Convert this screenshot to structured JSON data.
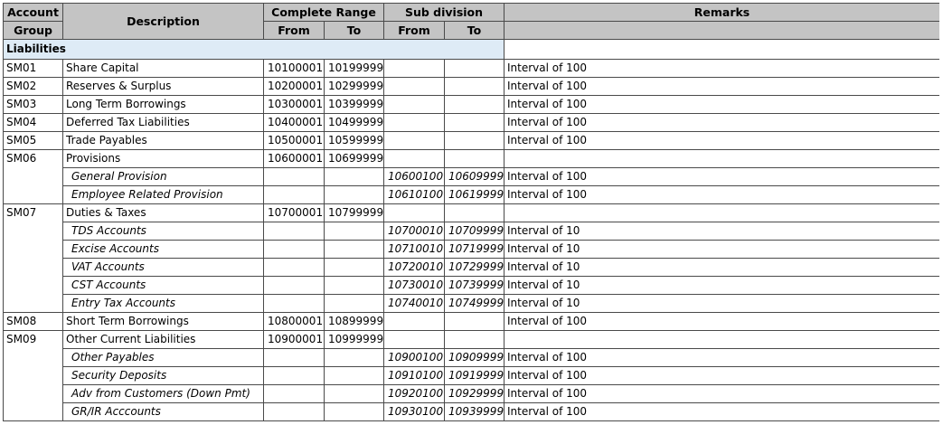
{
  "header": {
    "account_group": "Account Group",
    "account_group_line1": "Account",
    "account_group_line2": "Group",
    "description": "Description",
    "complete_range": "Complete Range",
    "sub_division": "Sub division",
    "remarks": "Remarks",
    "from": "From",
    "to": "To"
  },
  "section": "Liabilities",
  "rows": [
    {
      "group": "SM01",
      "desc": "Share Capital",
      "from": "10100001",
      "to": "10199999",
      "sub_from": "",
      "sub_to": "",
      "remarks": "Interval of 100",
      "sub": false
    },
    {
      "group": "SM02",
      "desc": "Reserves & Surplus",
      "from": "10200001",
      "to": "10299999",
      "sub_from": "",
      "sub_to": "",
      "remarks": "Interval of 100",
      "sub": false
    },
    {
      "group": "SM03",
      "desc": "Long Term Borrowings",
      "from": "10300001",
      "to": "10399999",
      "sub_from": "",
      "sub_to": "",
      "remarks": "Interval of 100",
      "sub": false
    },
    {
      "group": "SM04",
      "desc": "Deferred Tax Liabilities",
      "from": "10400001",
      "to": "10499999",
      "sub_from": "",
      "sub_to": "",
      "remarks": "Interval of 100",
      "sub": false
    },
    {
      "group": "SM05",
      "desc": "Trade Payables",
      "from": "10500001",
      "to": "10599999",
      "sub_from": "",
      "sub_to": "",
      "remarks": "Interval of 100",
      "sub": false
    },
    {
      "group": "SM06",
      "desc": "Provisions",
      "from": "10600001",
      "to": "10699999",
      "sub_from": "",
      "sub_to": "",
      "remarks": "",
      "sub": false
    },
    {
      "group": "",
      "desc": "General Provision",
      "from": "",
      "to": "",
      "sub_from": "10600100",
      "sub_to": "10609999",
      "remarks": "Interval of 100",
      "sub": true
    },
    {
      "group": "",
      "desc": "Employee Related Provision",
      "from": "",
      "to": "",
      "sub_from": "10610100",
      "sub_to": "10619999",
      "remarks": "Interval of 100",
      "sub": true
    },
    {
      "group": "SM07",
      "desc": "Duties & Taxes",
      "from": "10700001",
      "to": "10799999",
      "sub_from": "",
      "sub_to": "",
      "remarks": "",
      "sub": false
    },
    {
      "group": "",
      "desc": "TDS Accounts",
      "from": "",
      "to": "",
      "sub_from": "10700010",
      "sub_to": "10709999",
      "remarks": "Interval of 10",
      "sub": true
    },
    {
      "group": "",
      "desc": "Excise Accounts",
      "from": "",
      "to": "",
      "sub_from": "10710010",
      "sub_to": "10719999",
      "remarks": "Interval of 10",
      "sub": true
    },
    {
      "group": "",
      "desc": "VAT Accounts",
      "from": "",
      "to": "",
      "sub_from": "10720010",
      "sub_to": "10729999",
      "remarks": "Interval of 10",
      "sub": true
    },
    {
      "group": "",
      "desc": "CST Accounts",
      "from": "",
      "to": "",
      "sub_from": "10730010",
      "sub_to": "10739999",
      "remarks": "Interval of 10",
      "sub": true
    },
    {
      "group": "",
      "desc": "Entry Tax Accounts",
      "from": "",
      "to": "",
      "sub_from": "10740010",
      "sub_to": "10749999",
      "remarks": "Interval of 10",
      "sub": true
    },
    {
      "group": "SM08",
      "desc": "Short Term Borrowings",
      "from": "10800001",
      "to": "10899999",
      "sub_from": "",
      "sub_to": "",
      "remarks": "Interval of 100",
      "sub": false
    },
    {
      "group": "SM09",
      "desc": "Other Current Liabilities",
      "from": "10900001",
      "to": "10999999",
      "sub_from": "",
      "sub_to": "",
      "remarks": "",
      "sub": false
    },
    {
      "group": "",
      "desc": "Other Payables",
      "from": "",
      "to": "",
      "sub_from": "10900100",
      "sub_to": "10909999",
      "remarks": "Interval of 100",
      "sub": true
    },
    {
      "group": "",
      "desc": "Security Deposits",
      "from": "",
      "to": "",
      "sub_from": "10910100",
      "sub_to": "10919999",
      "remarks": "Interval of 100",
      "sub": true
    },
    {
      "group": "",
      "desc": "Adv from Customers (Down Pmt)",
      "from": "",
      "to": "",
      "sub_from": "10920100",
      "sub_to": "10929999",
      "remarks": "Interval of 100",
      "sub": true
    },
    {
      "group": "",
      "desc": "GR/IR Acccounts",
      "from": "",
      "to": "",
      "sub_from": "10930100",
      "sub_to": "10939999",
      "remarks": "Interval of 100",
      "sub": true
    }
  ]
}
